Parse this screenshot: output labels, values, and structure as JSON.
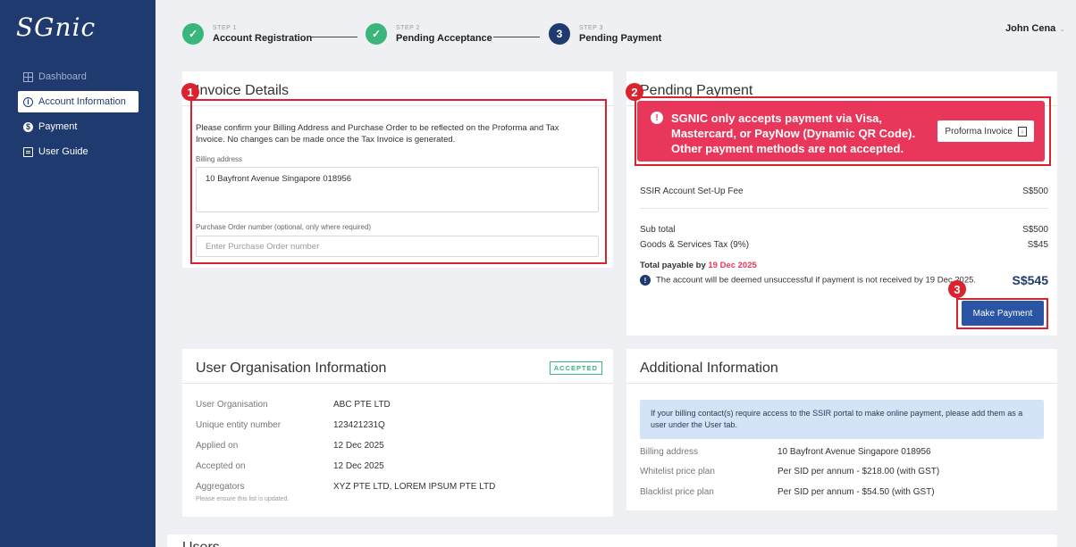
{
  "sidebar": {
    "logo": "SGnic",
    "items": [
      {
        "label": "Dashboard",
        "icon": "grid-icon"
      },
      {
        "label": "Account Information",
        "icon": "info-icon"
      },
      {
        "label": "Payment",
        "icon": "dollar-icon"
      },
      {
        "label": "User Guide",
        "icon": "document-icon"
      }
    ]
  },
  "steps": [
    {
      "num": "STEP 1",
      "label": "Account Registration",
      "status": "done"
    },
    {
      "num": "STEP 2",
      "label": "Pending Acceptance",
      "status": "done"
    },
    {
      "num": "STEP 3",
      "label": "Pending Payment",
      "status": "current",
      "index": "3"
    }
  ],
  "user": {
    "name": "John Cena"
  },
  "invoice": {
    "badge": "1",
    "title": "Invoice Details",
    "description": "Please confirm your Billing Address and Purchase Order to be reflected on the Proforma and Tax Invoice. No changes can be made once the Tax Invoice is generated.",
    "billing_label": "Billing address",
    "billing_value": "10 Bayfront Avenue Singapore 018956",
    "po_label": "Purchase Order number (optional, only where required)",
    "po_placeholder": "Enter Purchase Order number"
  },
  "payment": {
    "badge": "2",
    "title": "Pending Payment",
    "alert": "SGNIC only accepts payment via Visa, Mastercard, or PayNow (Dynamic QR Code). Other payment methods are not accepted.",
    "proforma_btn": "Proforma Invoice",
    "setup_fee_label": "SSIR Account Set-Up Fee",
    "setup_fee_value": "S$500",
    "subtotal_label": "Sub total",
    "subtotal_value": "S$500",
    "gst_label": "Goods & Services Tax (9%)",
    "gst_value": "S$45",
    "payable_label": "Total payable by",
    "payable_date": "19 Dec 2025",
    "warning": "The account will be deemed unsuccessful if payment is not received by 19 Dec 2025.",
    "total": "S$545",
    "pay_badge": "3",
    "pay_btn": "Make Payment"
  },
  "org": {
    "title": "User Organisation Information",
    "status": "ACCEPTED",
    "rows": [
      {
        "k": "User Organisation",
        "v": "ABC PTE LTD"
      },
      {
        "k": "Unique entity number",
        "v": "123421231Q"
      },
      {
        "k": "Applied on",
        "v": "12 Dec 2025"
      },
      {
        "k": "Accepted on",
        "v": "12 Dec 2025"
      },
      {
        "k": "Aggregators",
        "v": "XYZ PTE LTD, LOREM IPSUM PTE LTD"
      }
    ],
    "aggregator_note": "Please ensure this list is updated."
  },
  "additional": {
    "title": "Additional Information",
    "note": "If your billing contact(s) require access to the SSIR portal to make online payment, please add them as a user under the User tab.",
    "rows": [
      {
        "k": "Billing address",
        "v": "10 Bayfront Avenue Singapore 018956"
      },
      {
        "k": "Whitelist price plan",
        "v": "Per SID per annum - $218.00 (with GST)"
      },
      {
        "k": "Blacklist price plan",
        "v": "Per SID per annum - $54.50 (with GST)"
      }
    ]
  },
  "users": {
    "title": "Users"
  }
}
